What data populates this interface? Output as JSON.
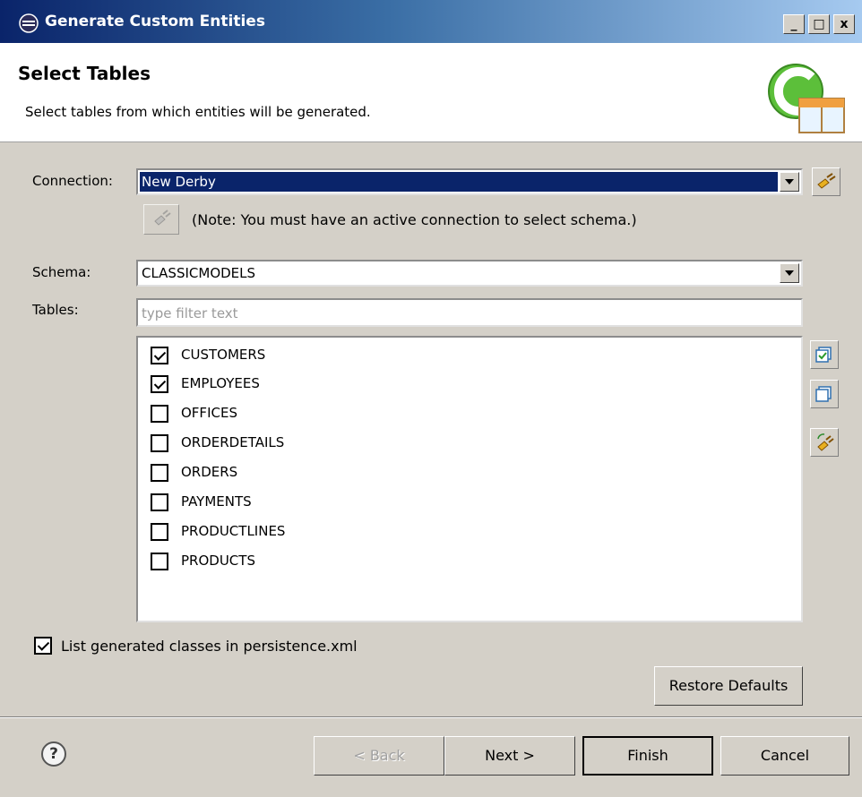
{
  "window": {
    "title": "Generate Custom Entities",
    "minimize": "_",
    "maximize": "□",
    "close": "x"
  },
  "header": {
    "title": "Select Tables",
    "description": "Select tables from which entities will be generated."
  },
  "connection": {
    "label": "Connection:",
    "value": "New Derby",
    "note": "(Note: You must have an active connection to select schema.)"
  },
  "schema": {
    "label": "Schema:",
    "value": "CLASSICMODELS"
  },
  "tables": {
    "label": "Tables:",
    "placeholder": "type filter text",
    "items": [
      {
        "name": "CUSTOMERS",
        "checked": true
      },
      {
        "name": "EMPLOYEES",
        "checked": true
      },
      {
        "name": "OFFICES",
        "checked": false
      },
      {
        "name": "ORDERDETAILS",
        "checked": false
      },
      {
        "name": "ORDERS",
        "checked": false
      },
      {
        "name": "PAYMENTS",
        "checked": false
      },
      {
        "name": "PRODUCTLINES",
        "checked": false
      },
      {
        "name": "PRODUCTS",
        "checked": false
      }
    ]
  },
  "options": {
    "list_generated": {
      "label": "List generated classes in persistence.xml",
      "checked": true
    }
  },
  "buttons": {
    "restore_defaults": "Restore Defaults",
    "back": "< Back",
    "next": "Next >",
    "finish": "Finish",
    "cancel": "Cancel"
  },
  "colors": {
    "title_bar": "#0a246a",
    "selection": "#0a246a",
    "dialog_bg": "#d4d0c8"
  }
}
